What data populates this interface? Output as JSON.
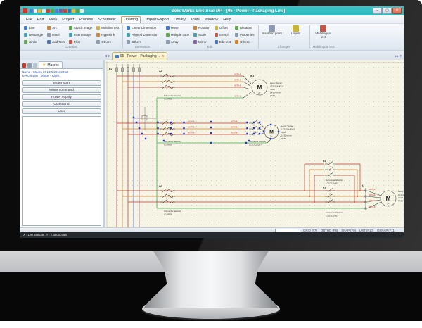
{
  "theme": {
    "titlebar": "#3cc6ca",
    "close": "#df6f58",
    "selection": "#2336cc",
    "canvas": "#f6f4e5",
    "status_bar": "#25282d",
    "wire_red": "#c0392b",
    "wire_orange": "#d2842f",
    "wire_green": "#3faf4c",
    "wire_blue": "#3a4ecb",
    "wire_purple": "#9b4f9b"
  },
  "window": {
    "title": "SolidWorks Electrical x64 - [05 - Power - Packaging Line]",
    "minimize": "–",
    "maximize": "▢",
    "close": "✕"
  },
  "menu": {
    "items": [
      "File",
      "Edit",
      "View",
      "Project",
      "Process",
      "Schematic",
      "Drawing",
      "Import/Export",
      "Library",
      "Tools",
      "Window",
      "Help"
    ]
  },
  "ribbon": {
    "groups": [
      {
        "label": "Creation",
        "buttons": [
          "Line",
          "Rectangle",
          "Circle",
          "Arc",
          "Hatch",
          "Add Text",
          "Attach Image",
          "Insert Image",
          "Fillet",
          "Multiline text",
          "Hyperlink",
          "Others"
        ]
      },
      {
        "label": "Dimension",
        "buttons": [
          "Linear Dimension",
          "Aligned Dimension",
          "Others"
        ]
      },
      {
        "label": "Edit",
        "buttons": [
          "Move",
          "Multiple copy",
          "Array",
          "Rotation",
          "Scale",
          "Mirror",
          "Offset",
          "Stretch",
          "Edit text",
          "Distance",
          "Properties",
          "Others"
        ]
      },
      {
        "label": "Changes",
        "buttons": [
          "Insertion point",
          "Layers"
        ]
      },
      {
        "label": "Multilingual text",
        "buttons": [
          "Multilingual text"
        ]
      }
    ]
  },
  "doc_tab": {
    "label": "05 - Power - Packaging ...",
    "close": "x",
    "nav_left": "◂",
    "nav_right": "▸",
    "corner": "◂ ▸ ▾"
  },
  "sidebar": {
    "tab": "Macros",
    "name_line": "Name : Macro 20130226112952",
    "desc_line": "Description : Motor - Right",
    "groups": [
      "Motor start",
      "Motor command",
      "Power supply",
      "Command",
      "User"
    ]
  },
  "command_bar": {
    "toggles": [
      "GRID (F7)",
      "ORTHO (F8)",
      "SNAP (F9)",
      "LWT (F10)",
      "OSNAP (F11)"
    ]
  },
  "status_bar": {
    "coords": "X : 1.97559035 , Y : 7.38000765"
  },
  "schematic": {
    "fuse_tag": "F1",
    "breaker_top_tag": "Q1",
    "breaker_bottom_tag": "Q2",
    "contactor_upper_tag": "K1",
    "contactor_lower_tag": "K2",
    "terminal_tag": "X1",
    "cable_tag": "W1",
    "motor_letter": "M",
    "motor_sub": "3~",
    "cable_label": "H07V-K",
    "mfr_breaker": {
      "name": "Schneider Electric",
      "ref": "U1UR36"
    },
    "mfr_contactor": {
      "name": "Schneider Electric",
      "ref": "LC1D1210B7"
    },
    "motor_specs": {
      "l1": "Leroy Somer",
      "l2": "LS112M-40/15",
      "l3": "4 kW",
      "l4": "1430 tr/min",
      "l5": "IP 55"
    }
  }
}
